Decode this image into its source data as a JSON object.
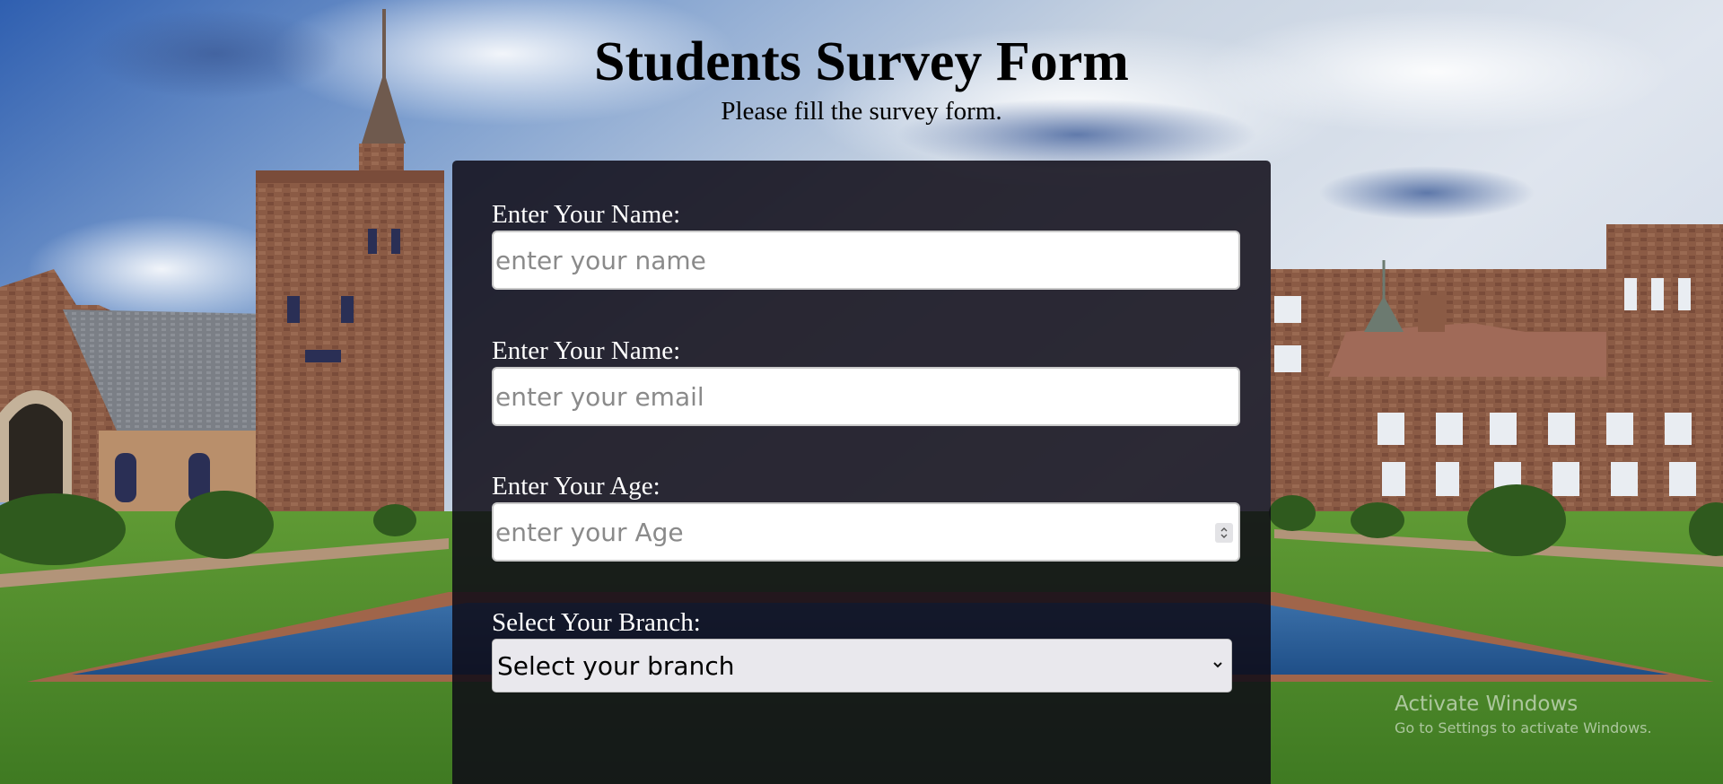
{
  "page": {
    "title": "Students Survey Form",
    "subtitle": "Please fill the survey form."
  },
  "form": {
    "name": {
      "label": "Enter Your Name:",
      "placeholder": "enter your name"
    },
    "email": {
      "label": "Enter Your Name:",
      "placeholder": "enter your email"
    },
    "age": {
      "label": "Enter Your Age:",
      "placeholder": "enter your Age"
    },
    "branch": {
      "label": "Select Your Branch:",
      "selected": "Select your branch"
    }
  },
  "watermark": {
    "title": "Activate Windows",
    "subtitle": "Go to Settings to activate Windows."
  },
  "colors": {
    "panel": "#0e0a16",
    "sky": "#5b7fb8",
    "grass": "#4f8a2a",
    "stone": "#8a5a45"
  }
}
